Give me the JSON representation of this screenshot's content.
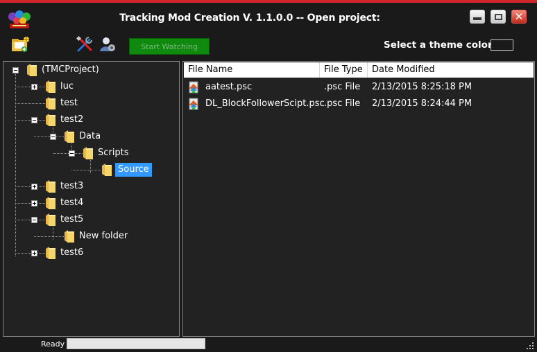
{
  "window": {
    "title": "Tracking Mod Creation V. 1.1.0.0 -- Open project:",
    "minimize_glyph": "",
    "maximize_glyph": "",
    "close_glyph": "✕"
  },
  "toolbar": {
    "new_project_icon": "new-folder-icon",
    "tools_icon": "tools-icon",
    "user_icon": "user-settings-icon",
    "start_button_label": "Start Watching",
    "theme_label": "Select a theme color",
    "theme_color": "#1a1a1a"
  },
  "tree": {
    "nodes": [
      {
        "label": "(TMCProject)",
        "expander": "minus",
        "level": 0
      },
      {
        "label": "luc",
        "expander": "plus",
        "level": 1
      },
      {
        "label": "test",
        "expander": "none",
        "level": 1
      },
      {
        "label": "test2",
        "expander": "minus",
        "level": 1
      },
      {
        "label": "Data",
        "expander": "minus",
        "level": 2
      },
      {
        "label": "Scripts",
        "expander": "minus",
        "level": 3
      },
      {
        "label": "Source",
        "expander": "none",
        "level": 4,
        "selected": true
      },
      {
        "label": "test3",
        "expander": "plus",
        "level": 1
      },
      {
        "label": "test4",
        "expander": "plus",
        "level": 1
      },
      {
        "label": "test5",
        "expander": "minus",
        "level": 1
      },
      {
        "label": "New folder",
        "expander": "none",
        "level": 2
      },
      {
        "label": "test6",
        "expander": "plus",
        "level": 1
      }
    ]
  },
  "file_list": {
    "columns": [
      "File Name",
      "File Type",
      "Date Modified"
    ],
    "rows": [
      {
        "name": "aatest.psc",
        "type": ".psc File",
        "modified": "2/13/2015 8:25:18 PM"
      },
      {
        "name": "DL_BlockFollowerScipt.psc",
        "type": ".psc File",
        "modified": "2/13/2015 8:24:44 PM"
      }
    ]
  },
  "status": {
    "text": "Ready",
    "progress": 0
  },
  "colors": {
    "accent_red": "#d0262b",
    "start_green": "#0f8a0f",
    "selection_blue": "#3399ff",
    "folder_yellow": "#f5d66b"
  }
}
